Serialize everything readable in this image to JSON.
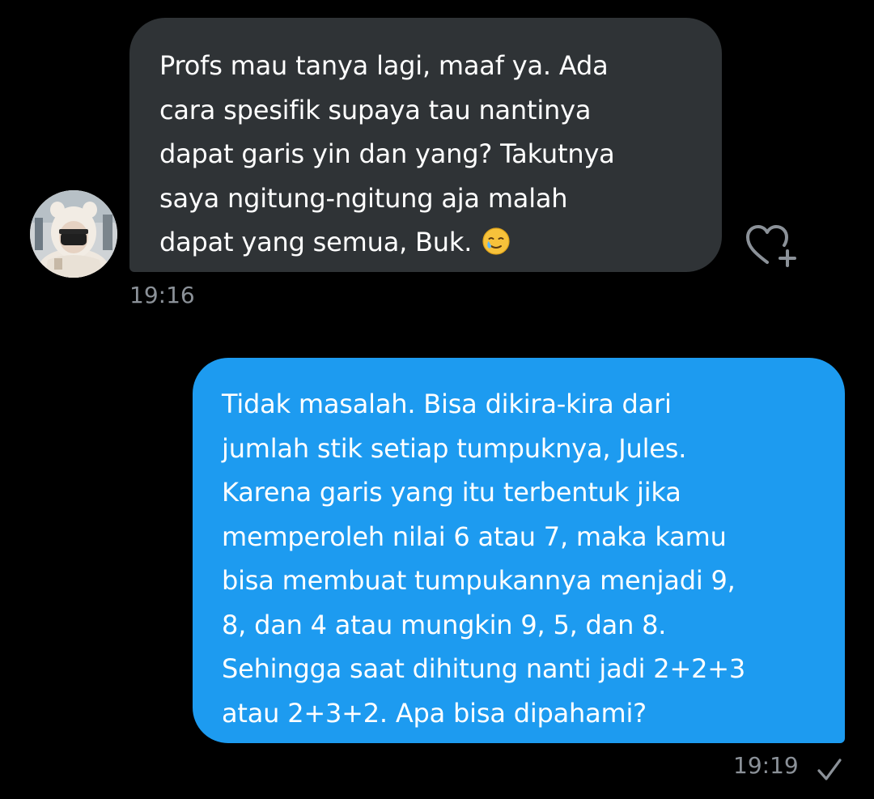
{
  "conversation": {
    "incoming": {
      "text": "Profs mau tanya lagi, maaf ya. Ada\ncara spesifik supaya tau nantinya\ndapat garis yin dan yang? Takutnya\nsaya ngitung-ngitung aja malah\ndapat yang semua, Buk.",
      "emoji": "🥲",
      "time": "19:16",
      "avatar_icon": "user-avatar",
      "react_icon": "heart-plus-icon"
    },
    "outgoing": {
      "text": "Tidak masalah. Bisa dikira-kira dari\njumlah stik setiap tumpuknya, Jules.\nKarena garis yang itu terbentuk jika\nmemperoleh nilai 6 atau 7, maka kamu\nbisa membuat tumpukannya menjadi 9,\n8, dan 4 atau mungkin 9, 5, dan 8.\nSehingga saat dihitung nanti jadi 2+2+3\natau 2+3+2. Apa bisa dipahami?",
      "time": "19:19",
      "status_icon": "checkmark-icon"
    }
  },
  "colors": {
    "background": "#000000",
    "incoming_bubble": "#2f3336",
    "outgoing_bubble": "#1d9bf0",
    "timestamp": "#8b9198"
  }
}
